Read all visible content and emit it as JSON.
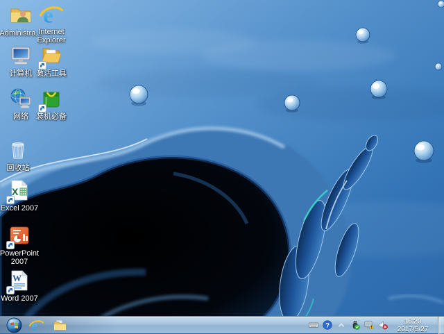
{
  "desktop": {
    "wallpaper": {
      "name": "water-splash",
      "colors": {
        "sky_light": "#8cbbe6",
        "sky_deep": "#2a66a8",
        "splash_dark": "#02060d",
        "accent_cyan": "#35d8cc"
      }
    },
    "icons": [
      {
        "id": "administrator",
        "label": "Administra...",
        "icon": "user-folder-icon",
        "shortcut": false
      },
      {
        "id": "internet-explorer",
        "label": "Internet Explorer",
        "icon": "ie-icon",
        "shortcut": false
      },
      {
        "id": "computer",
        "label": "计算机",
        "icon": "computer-monitor-icon",
        "shortcut": false
      },
      {
        "id": "activation-tools",
        "label": "激活工具",
        "icon": "open-folder-icon",
        "shortcut": true
      },
      {
        "id": "network",
        "label": "网络",
        "icon": "network-globe-icon",
        "shortcut": false
      },
      {
        "id": "essential-software",
        "label": "装机必备",
        "icon": "shopping-bag-icon",
        "shortcut": true
      },
      {
        "id": "recycle-bin",
        "label": "回收站",
        "icon": "recycle-bin-icon",
        "shortcut": false
      },
      {
        "id": "excel-2007",
        "label": "Excel 2007",
        "icon": "excel-icon",
        "shortcut": true
      },
      {
        "id": "powerpoint-2007",
        "label": "PowerPoint 2007",
        "icon": "powerpoint-icon",
        "shortcut": true
      },
      {
        "id": "word-2007",
        "label": "Word 2007",
        "icon": "word-icon",
        "shortcut": true
      }
    ]
  },
  "taskbar": {
    "start": {
      "icon": "windows-flag-icon"
    },
    "pinned": [
      {
        "id": "internet-explorer",
        "icon": "ie-icon"
      },
      {
        "id": "windows-explorer",
        "icon": "folder-icon"
      }
    ],
    "tray": {
      "icons": [
        {
          "name": "input-keyboard-icon"
        },
        {
          "name": "help-question-icon",
          "color": "#2a6cd4"
        },
        {
          "name": "show-hidden-icons-arrow"
        },
        {
          "name": "usb-safely-remove-icon",
          "badge_color": "#35b04a"
        },
        {
          "name": "network-warning-icon",
          "warning_color": "#f5c518"
        },
        {
          "name": "volume-muted-icon",
          "mute_color": "#d42a2a"
        }
      ],
      "clock": {
        "time": "16:20",
        "date": "2017/5/27"
      }
    }
  }
}
